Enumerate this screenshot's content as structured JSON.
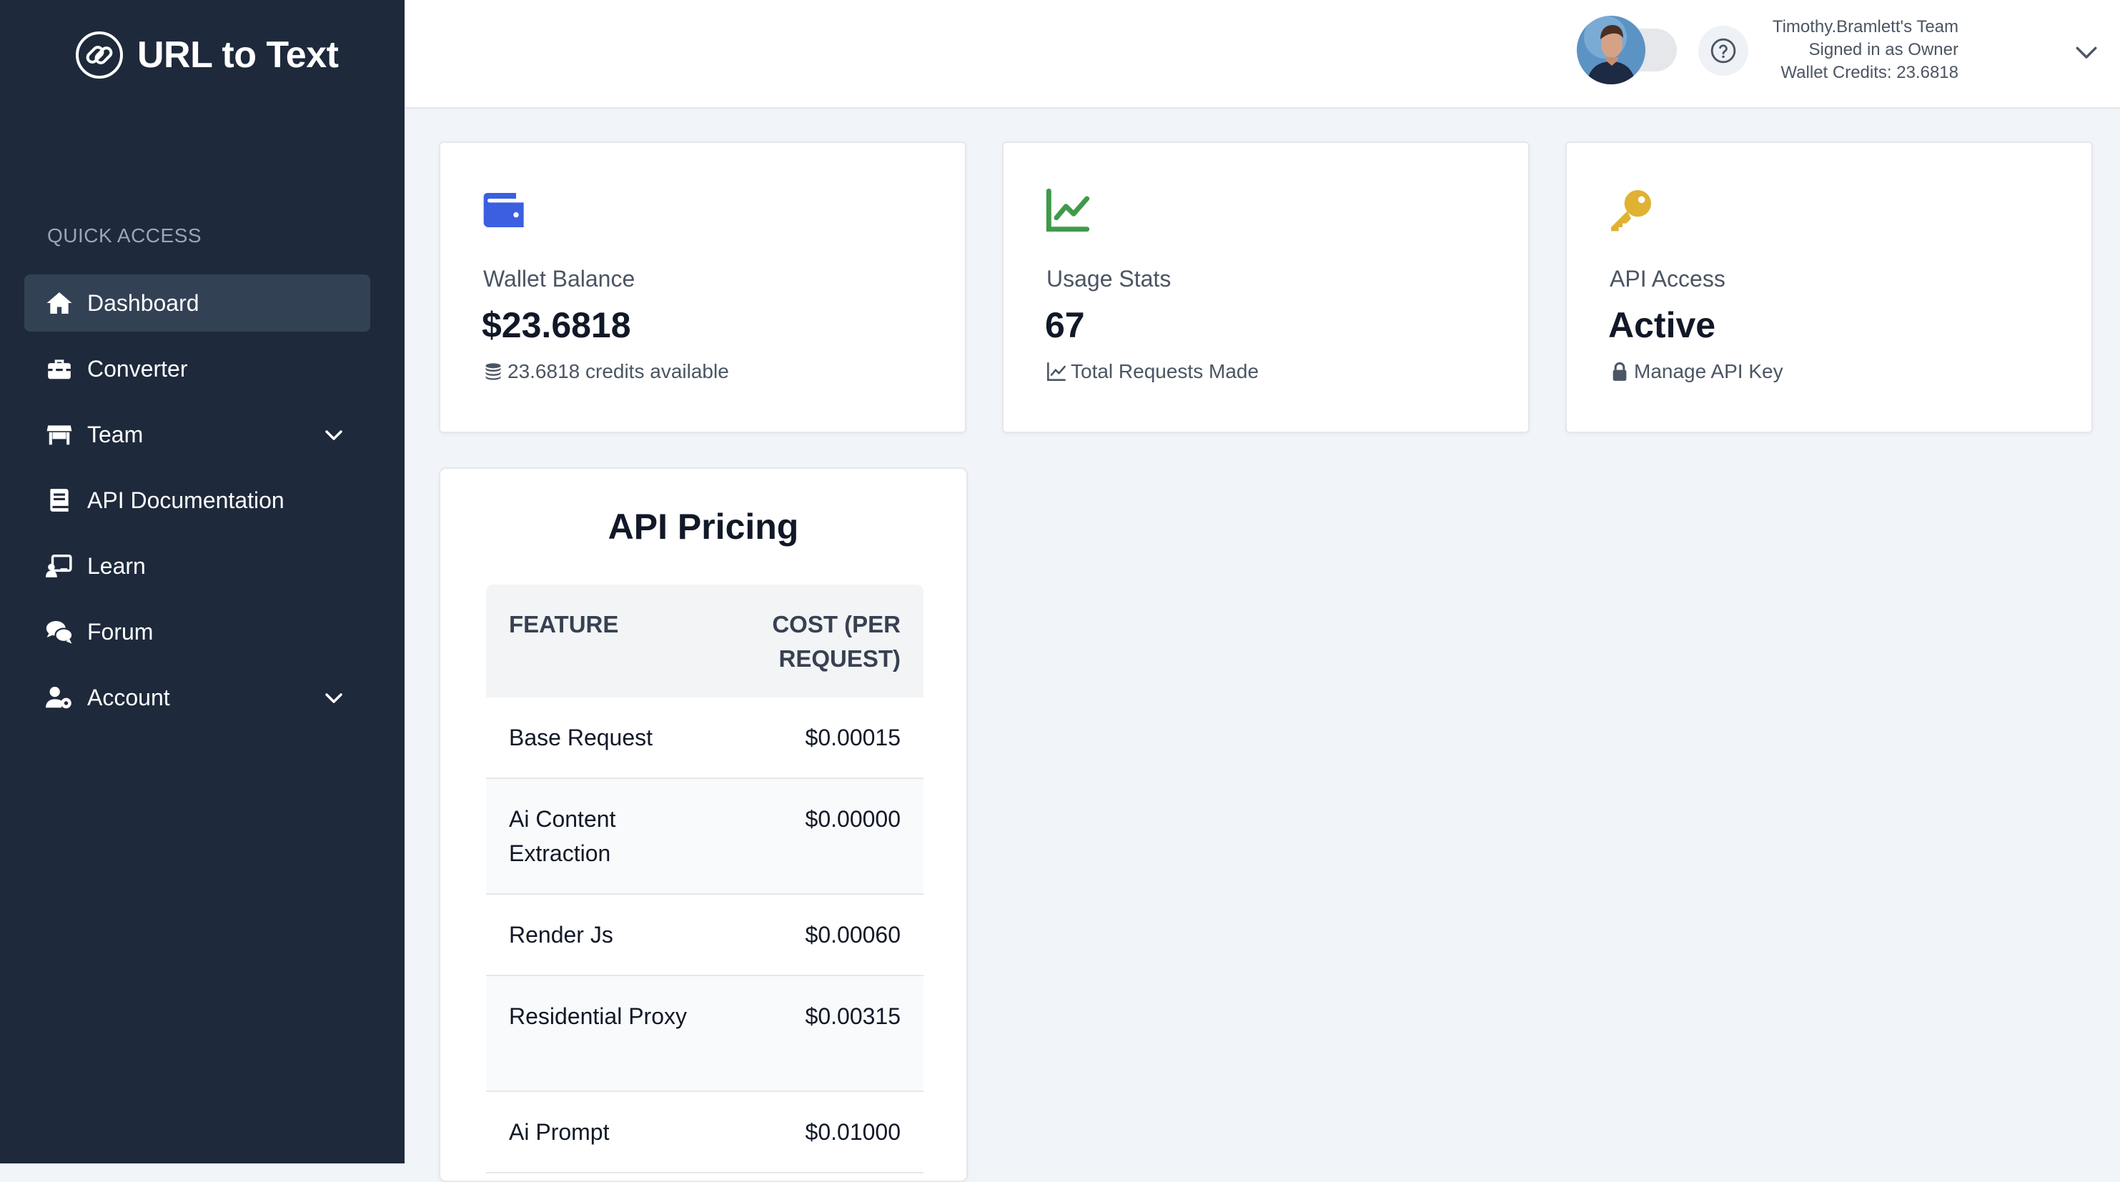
{
  "brand": {
    "name": "URL to Text"
  },
  "sidebar": {
    "section_label": "QUICK ACCESS",
    "items": [
      {
        "label": "Dashboard",
        "icon": "home-icon",
        "active": true
      },
      {
        "label": "Converter",
        "icon": "toolbox-icon"
      },
      {
        "label": "Team",
        "icon": "store-icon",
        "has_submenu": true
      },
      {
        "label": "API Documentation",
        "icon": "book-icon"
      },
      {
        "label": "Learn",
        "icon": "chalkboard-icon"
      },
      {
        "label": "Forum",
        "icon": "comments-icon"
      },
      {
        "label": "Account",
        "icon": "user-gear-icon",
        "has_submenu": true
      }
    ]
  },
  "header": {
    "team_name": "Timothy.Bramlett's Team",
    "signed_in_as": "Signed in as Owner",
    "wallet_credits": "Wallet Credits: 23.6818"
  },
  "cards": {
    "wallet": {
      "label": "Wallet Balance",
      "value": "$23.6818",
      "sub": "23.6818 credits available",
      "color": "#3b5fe0"
    },
    "usage": {
      "label": "Usage Stats",
      "value": "67",
      "sub": "Total Requests Made",
      "color": "#3f9a4a"
    },
    "api": {
      "label": "API Access",
      "value": "Active",
      "sub": "Manage API Key",
      "color": "#e0b232"
    }
  },
  "pricing": {
    "title": "API Pricing",
    "headers": {
      "feature": "FEATURE",
      "cost": "COST (PER REQUEST)"
    },
    "rows": [
      {
        "feature": "Base Request",
        "cost": "$0.00015"
      },
      {
        "feature": "Ai Content Extraction",
        "cost": "$0.00000"
      },
      {
        "feature": "Render Js",
        "cost": "$0.00060"
      },
      {
        "feature": "Residential Proxy",
        "cost": "$0.00315"
      },
      {
        "feature": "Ai Prompt",
        "cost": "$0.01000"
      }
    ]
  },
  "colors": {
    "sidebar_bg": "#1e293b",
    "active_bg": "#334155",
    "page_bg": "#f1f4f8"
  }
}
